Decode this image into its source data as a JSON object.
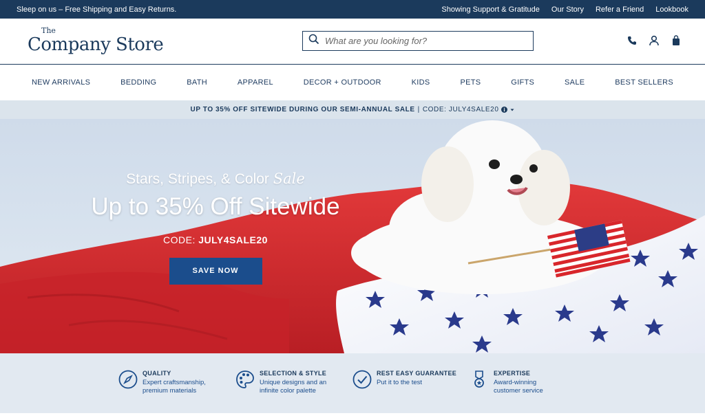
{
  "topbar": {
    "promo": "Sleep on us – Free Shipping and Easy Returns.",
    "links": [
      "Showing Support & Gratitude",
      "Our Story",
      "Refer a Friend",
      "Lookbook"
    ]
  },
  "header": {
    "logo_the": "The",
    "logo_name": "Company Store",
    "search_placeholder": "What are you looking for?",
    "icons": [
      "phone-icon",
      "account-icon",
      "bag-icon"
    ]
  },
  "nav": {
    "items": [
      "NEW ARRIVALS",
      "BEDDING",
      "BATH",
      "APPAREL",
      "DECOR + OUTDOOR",
      "KIDS",
      "PETS",
      "GIFTS",
      "SALE",
      "BEST SELLERS"
    ]
  },
  "promo_bar": {
    "text": "UP TO 35% OFF SITEWIDE DURING OUR SEMI-ANNUAL SALE",
    "separator": "|",
    "code": "CODE: JULY4SALE20"
  },
  "hero": {
    "subtitle_main": "Stars, Stripes, & Color",
    "subtitle_italic": "Sale",
    "title": "Up to 35% Off Sitewide",
    "code_label": "CODE:",
    "code_value": "JULY4SALE20",
    "button": "SAVE NOW"
  },
  "features": [
    {
      "title": "QUALITY",
      "desc1": "Expert craftsmanship,",
      "desc2": "premium materials",
      "icon": "compass-icon"
    },
    {
      "title": "SELECTION & STYLE",
      "desc1": "Unique designs and an",
      "desc2": "infinite color palette",
      "icon": "palette-icon"
    },
    {
      "title": "REST EASY GUARANTEE",
      "desc1": "Put it to the test",
      "desc2": "",
      "icon": "checkmark-icon"
    },
    {
      "title": "EXPERTISE",
      "desc1": "Award-winning",
      "desc2": "customer service",
      "icon": "medal-icon"
    }
  ],
  "colors": {
    "navy": "#1b3a5c",
    "button_blue": "#1b4d8c",
    "promo_bg": "#dbe4ec",
    "features_bg": "#e2e9f1",
    "red": "#d8262b"
  }
}
